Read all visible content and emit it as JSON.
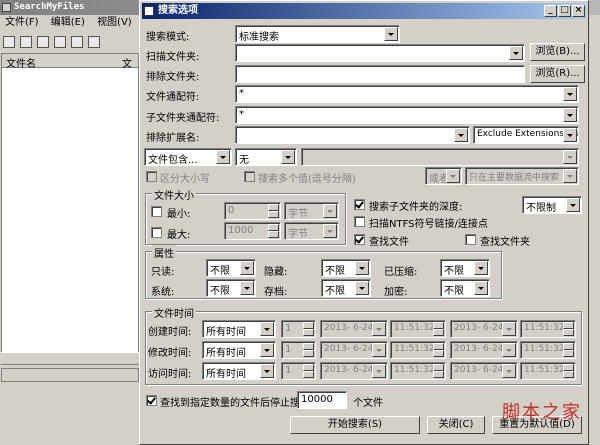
{
  "bg_app": {
    "title": "SearchMyFiles",
    "menu": [
      "文件(F)",
      "编辑(E)",
      "视图(V)"
    ],
    "columns": [
      "文件名",
      "文"
    ]
  },
  "dialog": {
    "title": "搜索选项",
    "search_mode": {
      "label": "搜索模式:",
      "value": "标准搜索"
    },
    "scan_folders": {
      "label": "扫描文件夹:",
      "value": "",
      "browse": "浏览(B)..."
    },
    "exclude_folders": {
      "label": "排除文件夹:",
      "value": "",
      "browse": "浏览(R)..."
    },
    "wildcard": {
      "label": "文件通配符:",
      "value": "*"
    },
    "subfolder_wildcard": {
      "label": "子文件夹通配符:",
      "value": "*"
    },
    "exclude_ext": {
      "label": "排除扩展名:",
      "value": "",
      "list": "Exclude Extensions List"
    },
    "contains": {
      "mode": "文件包含...",
      "type": "无",
      "text": ""
    },
    "case_sensitive": "区分大小写",
    "multi_values": "搜索多个值(逗号分隔)",
    "or_label": "或者",
    "main_stream": "只在主要数据流中搜索",
    "file_size": {
      "title": "文件大小",
      "min_label": "最小:",
      "min_value": "0",
      "min_unit": "字节",
      "max_label": "最大:",
      "max_value": "1000",
      "max_unit": "字节"
    },
    "subfolder_depth": {
      "label": "搜索子文件夹的深度:",
      "value": "不限制"
    },
    "ntfs_links": "扫描NTFS符号链接/连接点",
    "find_files": "查找文件",
    "find_folders": "查找文件夹",
    "attributes": {
      "title": "属性",
      "readonly": {
        "label": "只读:",
        "value": "不限"
      },
      "hidden": {
        "label": "隐藏:",
        "value": "不限"
      },
      "compressed": {
        "label": "已压缩:",
        "value": "不限"
      },
      "system": {
        "label": "系统:",
        "value": "不限"
      },
      "archive": {
        "label": "存档:",
        "value": "不限"
      },
      "encrypted": {
        "label": "加密:",
        "value": "不限"
      }
    },
    "file_time": {
      "title": "文件时间",
      "rows": [
        {
          "label": "创建时间:",
          "mode": "所有时间",
          "count": "1",
          "date1": "2013- 6-24",
          "time1": "11:51:32",
          "date2": "2013- 6-24",
          "time2": "11:51:32"
        },
        {
          "label": "修改时间:",
          "mode": "所有时间",
          "count": "1",
          "date1": "2013- 6-24",
          "time1": "11:51:32",
          "date2": "2013- 6-24",
          "time2": "11:51:32"
        },
        {
          "label": "访问时间:",
          "mode": "所有时间",
          "count": "1",
          "date1": "2013- 6-24",
          "time1": "11:51:32",
          "date2": "2013- 6-24",
          "time2": "11:51:32"
        }
      ]
    },
    "stop_after": {
      "label": "查找到指定数量的文件后停止搜索",
      "value": "10000",
      "unit": "个文件"
    },
    "buttons": {
      "start": "开始搜索(S)",
      "close": "关闭(C)",
      "reset": "重置为默认值(D)"
    }
  },
  "watermark": "脚本之家",
  "colors": {
    "titlebar_active": "#0a246a",
    "face": "#d4d0c8"
  }
}
